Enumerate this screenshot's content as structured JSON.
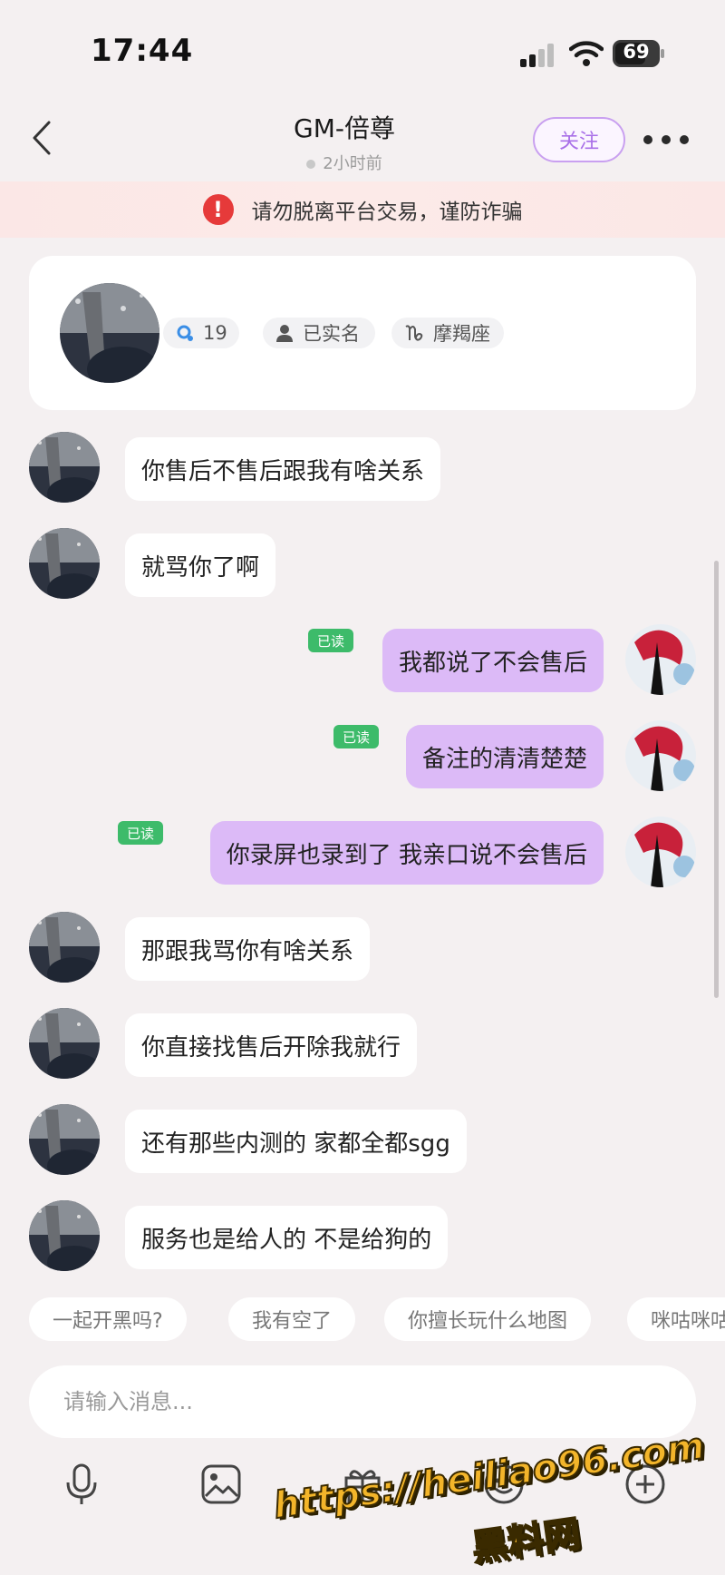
{
  "status_bar": {
    "time": "17:44",
    "battery": "69",
    "icons": [
      "signal-icon",
      "wifi-icon",
      "battery-icon"
    ]
  },
  "header": {
    "title": "GM-倍尊",
    "subtitle": "2小时前",
    "follow_label": "关注",
    "icons": [
      "back-arrow-icon",
      "more-dots-icon"
    ]
  },
  "warning": {
    "text": "请勿脱离平台交易，谨防诈骗",
    "icon": "exclamation-icon",
    "color": "#e63a3a"
  },
  "profile": {
    "tags": [
      {
        "icon": "level-icon",
        "label": "19"
      },
      {
        "icon": "person-icon",
        "label": "已实名"
      },
      {
        "icon": "capricorn-icon",
        "label": "摩羯座"
      }
    ]
  },
  "messages": [
    {
      "side": "in",
      "text": "你售后不售后跟我有啥关系"
    },
    {
      "side": "in",
      "text": "就骂你了啊"
    },
    {
      "side": "out",
      "text": "我都说了不会售后",
      "read": "已读"
    },
    {
      "side": "out",
      "text": "备注的清清楚楚",
      "read": "已读"
    },
    {
      "side": "out",
      "text": "你录屏也录到了 我亲口说不会售后",
      "read": "已读"
    },
    {
      "side": "in",
      "text": "那跟我骂你有啥关系"
    },
    {
      "side": "in",
      "text": "你直接找售后开除我就行"
    },
    {
      "side": "in",
      "text": "还有那些内测的 家都全都sgg"
    },
    {
      "side": "in",
      "text": "服务也是给人的  不是给狗的"
    }
  ],
  "quick_replies": [
    "一起开黑吗?",
    "我有空了",
    "你擅长玩什么地图",
    "咪咕咪咕"
  ],
  "input": {
    "placeholder": "请输入消息..."
  },
  "toolbar": {
    "icons": [
      "microphone-icon",
      "image-icon",
      "gift-icon",
      "emoji-icon",
      "plus-icon"
    ]
  },
  "colors": {
    "outgoing_bubble": "#dcbaf7",
    "accent": "#a970e8",
    "read_badge": "#3dbb6a"
  },
  "watermark": {
    "url": "https://heiliao96.com",
    "name": "黑料网"
  }
}
